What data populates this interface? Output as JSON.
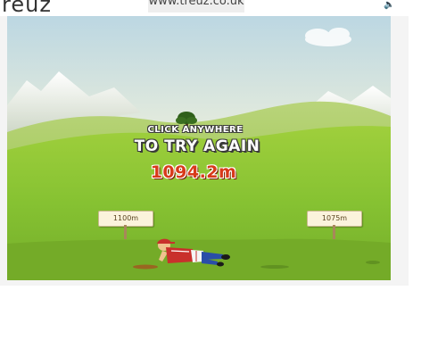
{
  "site": {
    "brand": "reuz",
    "url": "www.treuz.co.uk",
    "sound_icon": "speaker-icon"
  },
  "game": {
    "prompt_line1": "CLICK ANYWHERE",
    "prompt_line2": "TO TRY AGAIN",
    "distance": "1094.2m",
    "markers": [
      {
        "label": "1100m"
      },
      {
        "label": "1075m"
      }
    ]
  },
  "colors": {
    "distance_text": "#d83a1a",
    "grass": "#8cc63f",
    "sky": "#bcd7e2"
  }
}
